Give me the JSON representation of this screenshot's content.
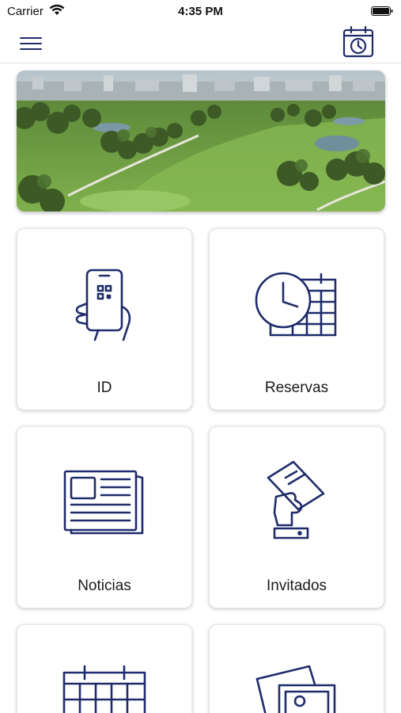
{
  "status_bar": {
    "carrier": "Carrier",
    "time": "4:35 PM"
  },
  "nav": {
    "menu_icon": "hamburger-menu-icon",
    "action_icon": "calendar-clock-icon"
  },
  "hero": {
    "image": "golf-course-photo"
  },
  "tiles": [
    {
      "label": "ID",
      "icon": "phone-qr-id-icon"
    },
    {
      "label": "Reservas",
      "icon": "clock-calendar-icon"
    },
    {
      "label": "Noticias",
      "icon": "newspaper-icon"
    },
    {
      "label": "Invitados",
      "icon": "hand-holding-card-icon"
    },
    {
      "label": "",
      "icon": "calendar-icon"
    },
    {
      "label": "",
      "icon": "photos-gallery-icon"
    }
  ],
  "colors": {
    "accent": "#1f2b6b",
    "tile_bg": "#ffffff",
    "divider": "#e3e3e3"
  }
}
